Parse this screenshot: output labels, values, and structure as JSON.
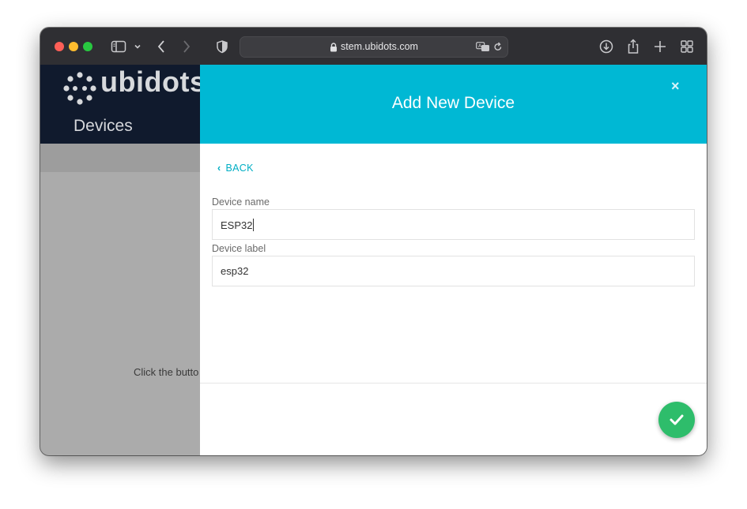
{
  "browser": {
    "url": "stem.ubidots.com"
  },
  "app": {
    "logo_text": "ubidots",
    "sidebar_title": "Devices",
    "background_hint": "Click the butto"
  },
  "modal": {
    "title": "Add New Device",
    "close_icon": "×",
    "back_label": "BACK",
    "fields": [
      {
        "label": "Device name",
        "value": "ESP32"
      },
      {
        "label": "Device label",
        "value": "esp32"
      }
    ],
    "confirm_icon": "check-icon"
  },
  "colors": {
    "modal_header": "#00b8d4",
    "sidebar": "#101a2d",
    "confirm_button": "#2ebd6b",
    "back_link": "#00aec4"
  }
}
